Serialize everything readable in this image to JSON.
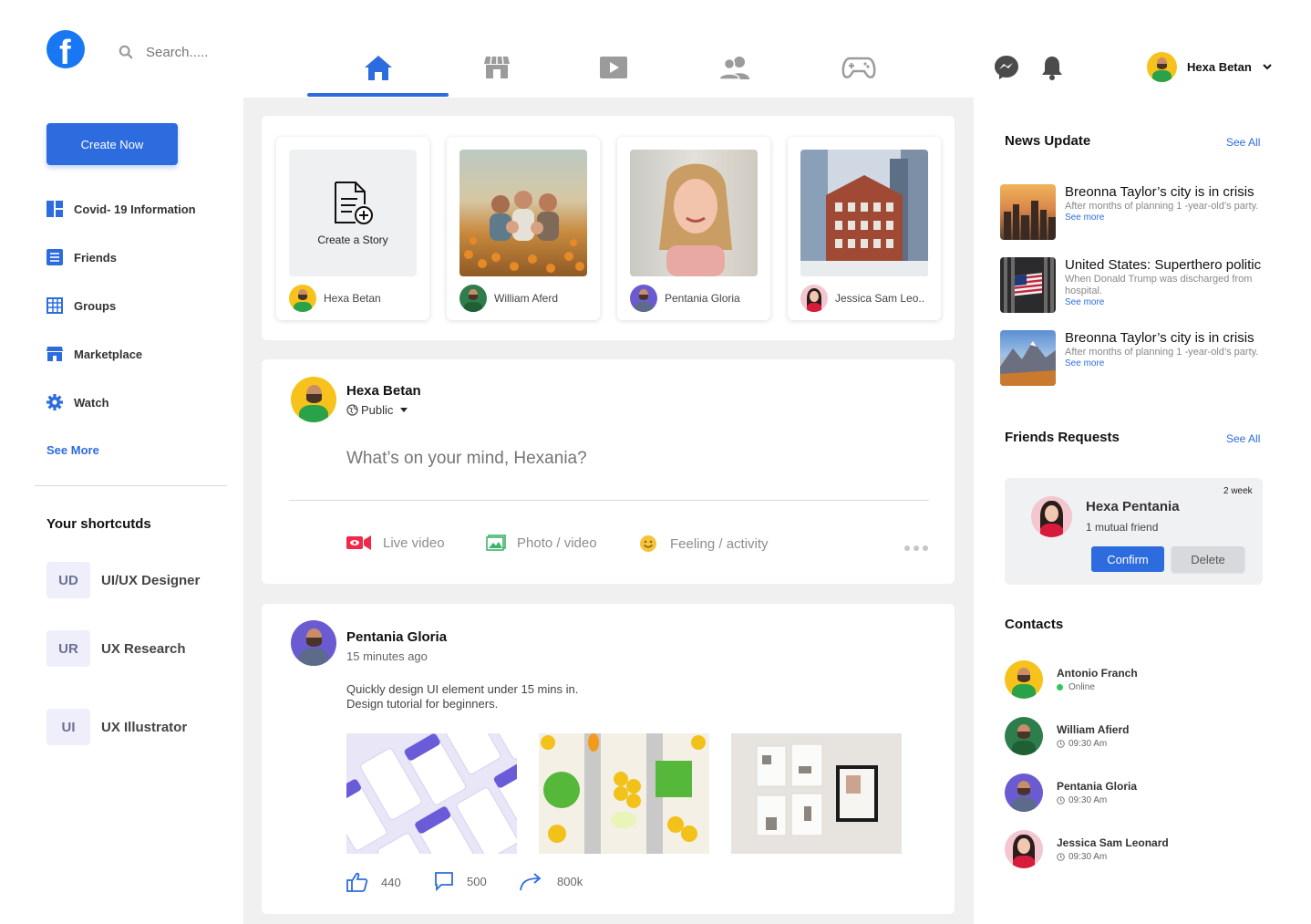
{
  "search": {
    "placeholder": "Search....."
  },
  "top_user": {
    "name": "Hexa Betan"
  },
  "sidebar": {
    "create_label": "Create Now",
    "items": [
      {
        "label": "Covid- 19 Information",
        "icon": "grid-icon"
      },
      {
        "label": "Friends",
        "icon": "list-icon"
      },
      {
        "label": "Groups",
        "icon": "table-icon"
      },
      {
        "label": "Marketplace",
        "icon": "store-icon"
      },
      {
        "label": "Watch",
        "icon": "gear-icon"
      }
    ],
    "see_more": "See More",
    "shortcuts_title": "Your shortcutds",
    "shortcuts": [
      {
        "badge": "UD",
        "label": "UI/UX Designer"
      },
      {
        "badge": "UR",
        "label": "UX Research"
      },
      {
        "badge": "UI",
        "label": "UX Illustrator"
      }
    ]
  },
  "stories": {
    "create_label": "Create a Story",
    "items": [
      {
        "name": "Hexa Betan"
      },
      {
        "name": "William Aferd"
      },
      {
        "name": "Pentania Gloria"
      },
      {
        "name": "Jessica Sam Leo.."
      }
    ]
  },
  "composer": {
    "name": "Hexa Betan",
    "privacy": "Public",
    "placeholder": "What’s on your mind, Hexania?",
    "actions": [
      "Live video",
      "Photo / video",
      "Feeling / activity"
    ]
  },
  "post": {
    "author": "Pentania Gloria",
    "time": "15 minutes ago",
    "text_line1": "Quickly design UI element under 15 mins in.",
    "text_line2": "Design tutorial for beginners.",
    "likes": "440",
    "comments": "500",
    "shares": "800k"
  },
  "news": {
    "title": "News Update",
    "see_all": "See All",
    "items": [
      {
        "headline": "Breonna Taylor’s city is in crisis",
        "desc": "After months of planning 1 -year-old’s party.",
        "more": "See more"
      },
      {
        "headline": "United States: Superthero politic",
        "desc": "When Donald Trump was discharged from hospital.",
        "more": "See more"
      },
      {
        "headline": "Breonna Taylor’s city is in crisis",
        "desc": "After months of planning 1 -year-old’s party.",
        "more": "See more"
      }
    ]
  },
  "requests": {
    "title": "Friends Requests",
    "see_all": "See All",
    "name": "Hexa Pentania",
    "mutual": "1 mutual friend",
    "time": "2 week",
    "confirm": "Confirm",
    "delete": "Delete"
  },
  "contacts": {
    "title": "Contacts",
    "items": [
      {
        "name": "Antonio Franch",
        "status": "Online"
      },
      {
        "name": "William Afierd",
        "status": "09:30 Am"
      },
      {
        "name": "Pentania Gloria",
        "status": "09:30 Am"
      },
      {
        "name": "Jessica Sam Leonard",
        "status": "09:30 Am"
      }
    ]
  },
  "colors": {
    "accent": "#2d6cdf",
    "brand": "#1877f2",
    "online": "#31c75a"
  }
}
